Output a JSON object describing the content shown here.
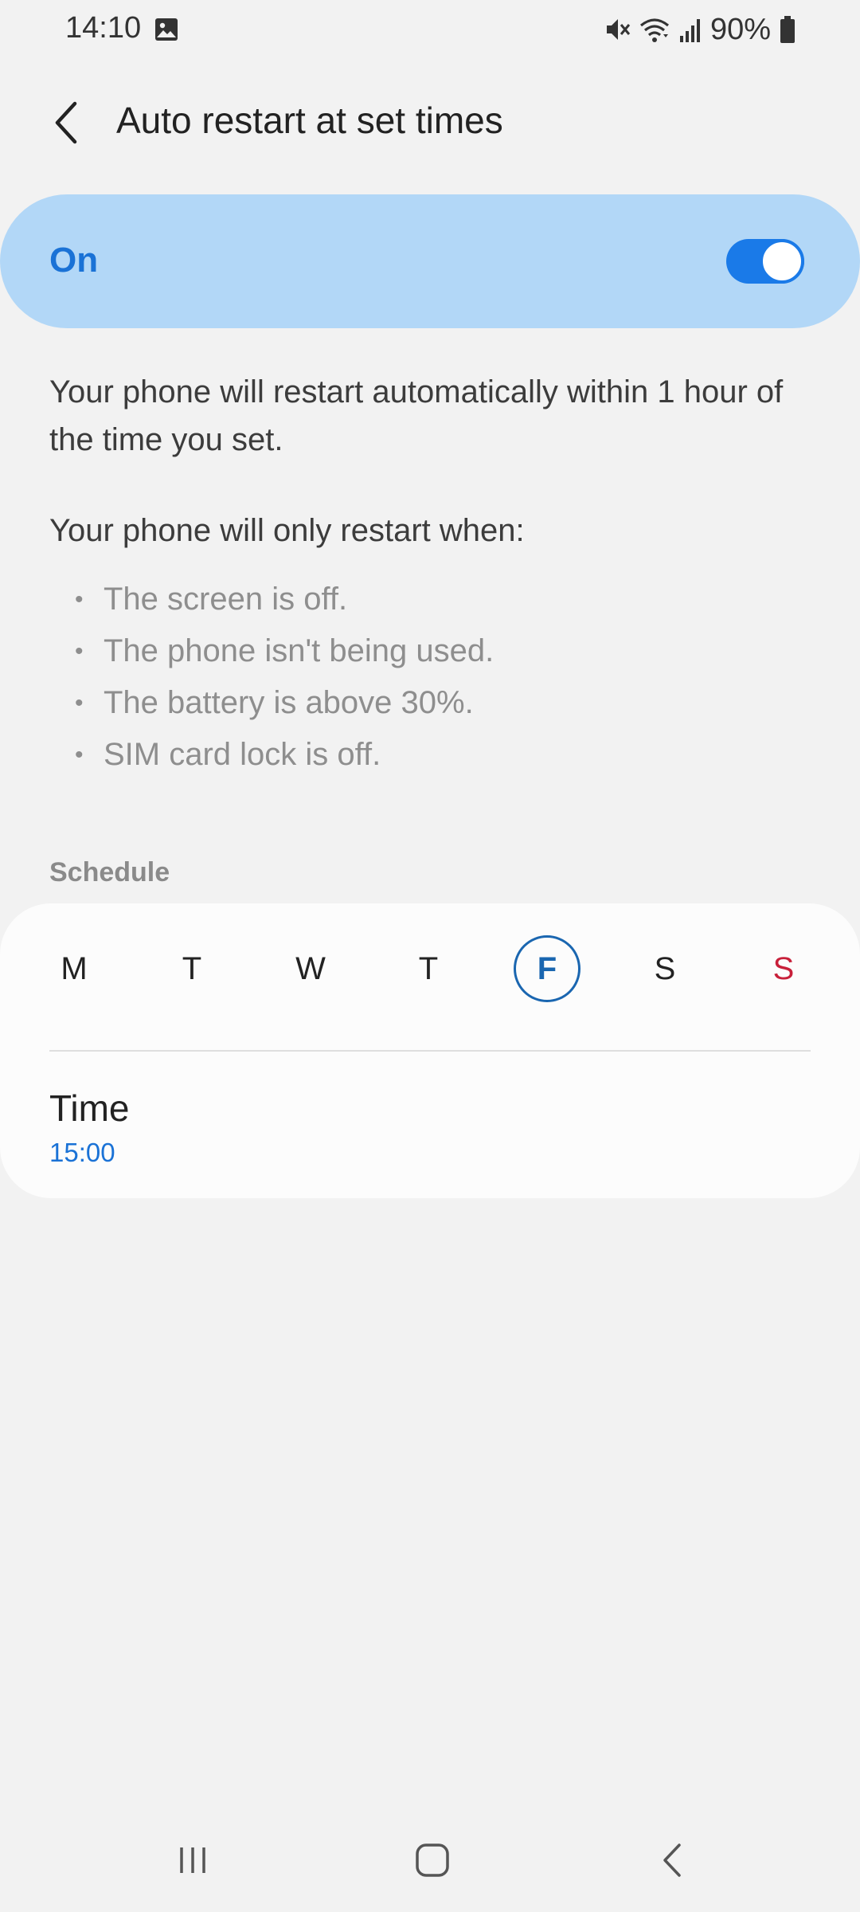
{
  "status_bar": {
    "time": "14:10",
    "battery_text": "90%",
    "icons": [
      "gallery-icon",
      "mute-icon",
      "wifi-icon",
      "signal-icon",
      "battery-icon"
    ]
  },
  "header": {
    "title": "Auto restart at set times",
    "back_icon": "chevron-left-icon"
  },
  "master_switch": {
    "label": "On",
    "state": true
  },
  "description": "Your phone will restart automatically within 1 hour of the time you set.",
  "conditions": {
    "intro": "Your phone will only restart when:",
    "items": [
      "The screen is off.",
      "The phone isn't being used.",
      "The battery is above 30%.",
      "SIM card lock is off."
    ]
  },
  "schedule": {
    "section_label": "Schedule",
    "days": [
      {
        "label": "M",
        "selected": false
      },
      {
        "label": "T",
        "selected": false
      },
      {
        "label": "W",
        "selected": false
      },
      {
        "label": "T",
        "selected": false
      },
      {
        "label": "F",
        "selected": true
      },
      {
        "label": "S",
        "selected": false
      },
      {
        "label": "S",
        "selected": false
      }
    ],
    "time_label": "Time",
    "time_value": "15:00"
  },
  "colors": {
    "accent": "#1a72d6",
    "master_card": "#b2d7f7",
    "selected_day": "#1a66b0",
    "sunday": "#c8203a",
    "background": "#f2f2f2"
  },
  "nav_bar": {
    "icons": [
      "recent-apps-icon",
      "home-icon",
      "back-icon"
    ]
  }
}
